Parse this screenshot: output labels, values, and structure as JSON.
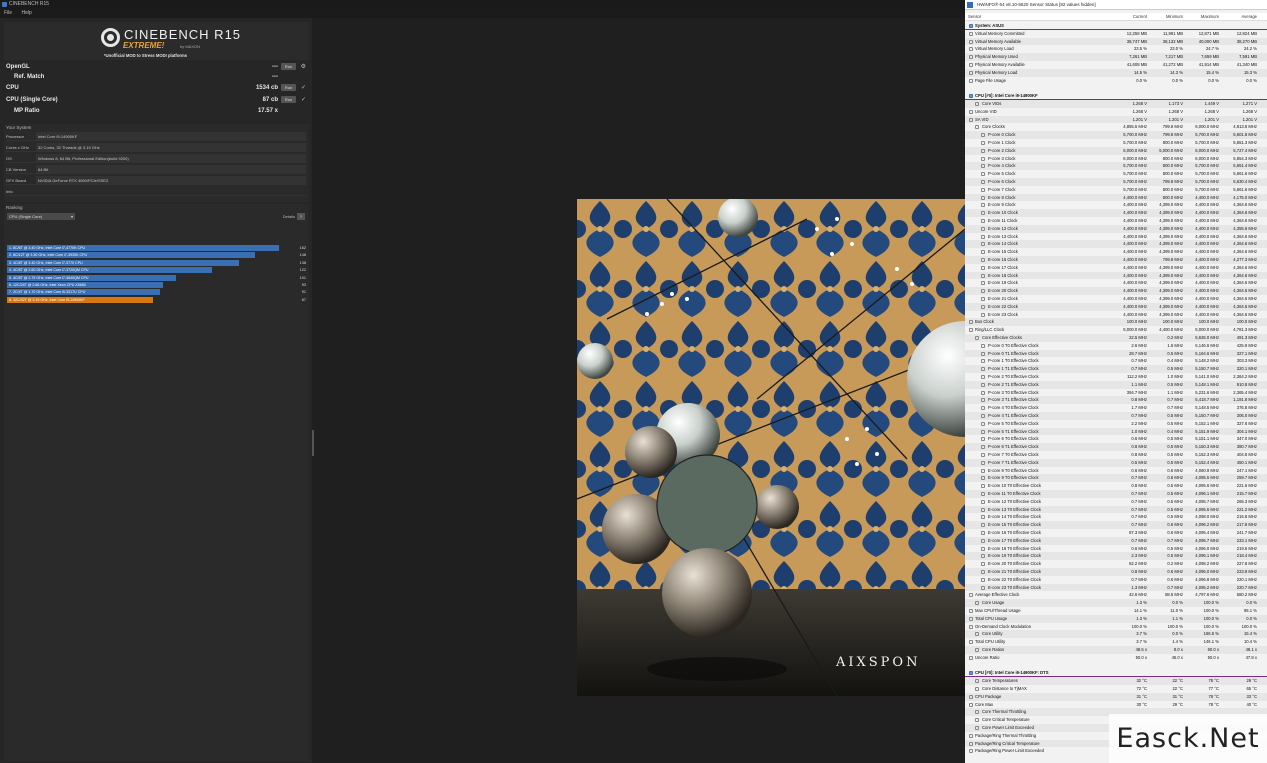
{
  "cinebench": {
    "window_title": "CINEBENCH R15",
    "menu": [
      "File",
      "Help"
    ],
    "logo": {
      "name": "CINEBENCH R15",
      "edition": "EXTREME!",
      "by": "by MAXON",
      "mod_note": "*Unofficial MOD to Stress MODI platforms"
    },
    "scores": {
      "opengl_label": "OpenGL",
      "opengl_value": "---",
      "refmatch_label": "Ref. Match",
      "refmatch_value": "---",
      "cpu_label": "CPU",
      "cpu_value": "1534 cb",
      "single_label": "CPU (Single Core)",
      "single_value": "87 cb",
      "mp_label": "MP Ratio",
      "mp_value": "17.57 x",
      "run_label": "Run"
    },
    "system": {
      "heading": "Your System",
      "rows": [
        {
          "k": "Processor",
          "v": "Intel Core i9-14900KF"
        },
        {
          "k": "Cores x GHz",
          "v": "32 Cores, 32 Threads @ 3.19 GHz"
        },
        {
          "k": "OS",
          "v": "Windows 8, 64 Bit, Professional Edition(build 9200)"
        },
        {
          "k": "CB Version",
          "v": "64 Bit"
        },
        {
          "k": "GFX Board",
          "v": "NVIDIA GeForce RTX 4080/PCIe/SSE2"
        },
        {
          "k": "Info",
          "v": ""
        }
      ]
    },
    "ranking": {
      "heading": "Ranking",
      "select": "CPU (Single Core)",
      "details": "Details",
      "info": "?",
      "items": [
        {
          "label": "1. 6C/6T @ 3.40 GHz, Intel Core i7-4770K CPU",
          "score": "162",
          "pct": 1.0,
          "mine": false
        },
        {
          "label": "2. 6C/12T @ 3.30 GHz, Intel Core i7-3930K CPU",
          "score": "148",
          "pct": 0.913,
          "mine": false
        },
        {
          "label": "3. 4C/8T @ 3.40 GHz, Intel Core i7-3770 CPU",
          "score": "138",
          "pct": 0.852,
          "mine": false
        },
        {
          "label": "4. 4C/8T @ 2.60 GHz, Intel Core i7-3720QM CPU",
          "score": "122",
          "pct": 0.753,
          "mine": false
        },
        {
          "label": "5. 4C/8T @ 2.79 GHz, Intel Core i7-3840QM CPU",
          "score": "101",
          "pct": 0.623,
          "mine": false
        },
        {
          "label": "6. 12C/24T @ 2.66 GHz, Intel Xeon CPU X5650",
          "score": "93",
          "pct": 0.574,
          "mine": false
        },
        {
          "label": "7. 2C/4T @ 1.70 GHz, Intel Core i5-3317U CPU",
          "score": "91",
          "pct": 0.562,
          "mine": false
        },
        {
          "label": "8. 32C/32T @ 3.19 GHz, Intel Core i9-14900KF",
          "score": "87",
          "pct": 0.537,
          "mine": true
        }
      ]
    },
    "scene_wordmark": "AIXSPON"
  },
  "hwinfo": {
    "window_title": "HWiNFO® 64 v8.10-5520 Sensor Status [82 values hidden]",
    "columns": {
      "sensor": "Sensor",
      "current": "Current",
      "min": "Minimum",
      "max": "Maximum",
      "avg": "Average"
    },
    "rows": [
      {
        "n": "System: ASUS",
        "sec": true
      },
      {
        "n": "Virtual Memory Committed",
        "c": [
          "12,258 MB",
          "11,991 MB",
          "12,871 MB",
          "12,824 MB"
        ]
      },
      {
        "n": "Virtual Memory Available",
        "c": [
          "38,747 MB",
          "38,132 MB",
          "40,000 MB",
          "38,270 MB"
        ]
      },
      {
        "n": "Virtual Memory Load",
        "c": [
          "23.5 %",
          "23.0 %",
          "24.7 %",
          "24.2 %"
        ]
      },
      {
        "n": "Physical Memory Used",
        "c": [
          "7,261 MB",
          "7,217 MB",
          "7,659 MB",
          "7,591 MB"
        ]
      },
      {
        "n": "Physical Memory Available",
        "c": [
          "41,608 MB",
          "41,272 MB",
          "41,914 MB",
          "41,340 MB"
        ]
      },
      {
        "n": "Physical Memory Load",
        "c": [
          "14.5 %",
          "14.3 %",
          "15.4 %",
          "15.3 %"
        ]
      },
      {
        "n": "Page File Usage",
        "c": [
          "0.0 %",
          "0.0 %",
          "0.0 %",
          "0.0 %"
        ]
      },
      {
        "n": "",
        "blank": true
      },
      {
        "n": "CPU [#0]: Intel Core i9-14900KF",
        "sec": true
      },
      {
        "n": "Core VIDs",
        "c": [
          "1.268 V",
          "1.173 V",
          "1.449 V",
          "1.271 V"
        ],
        "d": 2
      },
      {
        "n": "Uncore VID",
        "c": [
          "1.268 V",
          "1.268 V",
          "1.268 V",
          "1.268 V"
        ]
      },
      {
        "n": "SA VID",
        "c": [
          "1.201 V",
          "1.201 V",
          "1.201 V",
          "1.201 V"
        ]
      },
      {
        "n": "Core Clocks",
        "c": [
          "4,855.5 MHz",
          "799.8 MHz",
          "6,000.0 MHz",
          "4,813.8 MHz"
        ],
        "d": 2
      },
      {
        "n": "P-core 0 Clock",
        "c": [
          "5,700.0 MHz",
          "799.8 MHz",
          "5,700.0 MHz",
          "5,601.8 MHz"
        ],
        "d": 3
      },
      {
        "n": "P-core 1 Clock",
        "c": [
          "5,700.0 MHz",
          "800.0 MHz",
          "5,700.0 MHz",
          "5,651.3 MHz"
        ],
        "d": 3
      },
      {
        "n": "P-core 2 Clock",
        "c": [
          "6,000.0 MHz",
          "5,000.0 MHz",
          "6,000.0 MHz",
          "5,727.4 MHz"
        ],
        "d": 3
      },
      {
        "n": "P-core 3 Clock",
        "c": [
          "6,000.0 MHz",
          "800.0 MHz",
          "6,000.0 MHz",
          "5,854.3 MHz"
        ],
        "d": 3
      },
      {
        "n": "P-core 4 Clock",
        "c": [
          "5,700.0 MHz",
          "800.0 MHz",
          "5,700.0 MHz",
          "5,651.4 MHz"
        ],
        "d": 3
      },
      {
        "n": "P-core 5 Clock",
        "c": [
          "5,700.0 MHz",
          "800.0 MHz",
          "5,700.0 MHz",
          "5,661.6 MHz"
        ],
        "d": 3
      },
      {
        "n": "P-core 6 Clock",
        "c": [
          "5,700.0 MHz",
          "799.8 MHz",
          "5,700.0 MHz",
          "5,630.4 MHz"
        ],
        "d": 3
      },
      {
        "n": "P-core 7 Clock",
        "c": [
          "5,700.0 MHz",
          "800.0 MHz",
          "5,700.0 MHz",
          "5,661.6 MHz"
        ],
        "d": 3
      },
      {
        "n": "E-core 8 Clock",
        "c": [
          "4,400.0 MHz",
          "800.0 MHz",
          "4,400.0 MHz",
          "4,175.0 MHz"
        ],
        "d": 3
      },
      {
        "n": "E-core 9 Clock",
        "c": [
          "4,400.0 MHz",
          "4,399.0 MHz",
          "4,400.0 MHz",
          "4,364.6 MHz"
        ],
        "d": 3
      },
      {
        "n": "E-core 10 Clock",
        "c": [
          "4,400.0 MHz",
          "4,399.0 MHz",
          "4,400.0 MHz",
          "4,364.6 MHz"
        ],
        "d": 3
      },
      {
        "n": "E-core 11 Clock",
        "c": [
          "4,400.0 MHz",
          "4,399.0 MHz",
          "4,400.0 MHz",
          "4,364.6 MHz"
        ],
        "d": 3
      },
      {
        "n": "E-core 12 Clock",
        "c": [
          "4,400.0 MHz",
          "4,399.0 MHz",
          "4,400.0 MHz",
          "4,355.6 MHz"
        ],
        "d": 3
      },
      {
        "n": "E-core 13 Clock",
        "c": [
          "4,400.0 MHz",
          "4,399.0 MHz",
          "4,400.0 MHz",
          "4,364.6 MHz"
        ],
        "d": 3
      },
      {
        "n": "E-core 14 Clock",
        "c": [
          "4,400.0 MHz",
          "4,399.0 MHz",
          "4,400.0 MHz",
          "4,364.6 MHz"
        ],
        "d": 3
      },
      {
        "n": "E-core 15 Clock",
        "c": [
          "4,400.0 MHz",
          "4,399.0 MHz",
          "4,400.0 MHz",
          "4,364.6 MHz"
        ],
        "d": 3
      },
      {
        "n": "E-core 16 Clock",
        "c": [
          "4,400.0 MHz",
          "799.8 MHz",
          "4,400.0 MHz",
          "4,277.3 MHz"
        ],
        "d": 3
      },
      {
        "n": "E-core 17 Clock",
        "c": [
          "4,400.0 MHz",
          "4,399.0 MHz",
          "4,400.0 MHz",
          "4,364.6 MHz"
        ],
        "d": 3
      },
      {
        "n": "E-core 18 Clock",
        "c": [
          "4,400.0 MHz",
          "4,399.0 MHz",
          "4,400.0 MHz",
          "4,364.6 MHz"
        ],
        "d": 3
      },
      {
        "n": "E-core 19 Clock",
        "c": [
          "4,400.0 MHz",
          "4,399.0 MHz",
          "4,400.0 MHz",
          "4,364.6 MHz"
        ],
        "d": 3
      },
      {
        "n": "E-core 20 Clock",
        "c": [
          "4,400.0 MHz",
          "4,399.0 MHz",
          "4,400.0 MHz",
          "4,364.6 MHz"
        ],
        "d": 3
      },
      {
        "n": "E-core 21 Clock",
        "c": [
          "4,400.0 MHz",
          "4,399.0 MHz",
          "4,400.0 MHz",
          "4,364.6 MHz"
        ],
        "d": 3
      },
      {
        "n": "E-core 22 Clock",
        "c": [
          "4,400.0 MHz",
          "4,399.0 MHz",
          "4,400.0 MHz",
          "4,364.6 MHz"
        ],
        "d": 3
      },
      {
        "n": "E-core 23 Clock",
        "c": [
          "4,400.0 MHz",
          "4,399.0 MHz",
          "4,400.0 MHz",
          "4,364.6 MHz"
        ],
        "d": 3
      },
      {
        "n": "Bus Clock",
        "c": [
          "100.0 MHz",
          "100.0 MHz",
          "100.0 MHz",
          "100.0 MHz"
        ]
      },
      {
        "n": "Ring/LLC Clock",
        "c": [
          "5,000.0 MHz",
          "4,400.0 MHz",
          "5,000.0 MHz",
          "4,781.3 MHz"
        ]
      },
      {
        "n": "Core Effective Clocks",
        "c": [
          "22.5 MHz",
          "0.2 MHz",
          "5,636.0 MHz",
          "491.3 MHz"
        ],
        "d": 2
      },
      {
        "n": "P-core 0 T0 Effective Clock",
        "c": [
          "2.6 MHz",
          "1.6 MHz",
          "5,146.6 MHz",
          "425.9 MHz"
        ],
        "d": 3
      },
      {
        "n": "P-core 0 T1 Effective Clock",
        "c": [
          "28.7 MHz",
          "0.5 MHz",
          "5,164.6 MHz",
          "327.1 MHz"
        ],
        "d": 3
      },
      {
        "n": "P-core 1 T0 Effective Clock",
        "c": [
          "0.7 MHz",
          "0.4 MHz",
          "5,148.2 MHz",
          "303.3 MHz"
        ],
        "d": 3
      },
      {
        "n": "P-core 1 T1 Effective Clock",
        "c": [
          "0.7 MHz",
          "0.5 MHz",
          "5,150.7 MHz",
          "320.1 MHz"
        ],
        "d": 3
      },
      {
        "n": "P-core 2 T0 Effective Clock",
        "c": [
          "112.2 MHz",
          "1.0 MHz",
          "5,141.0 MHz",
          "2,364.2 MHz"
        ],
        "d": 3
      },
      {
        "n": "P-core 2 T1 Effective Clock",
        "c": [
          "1.1 MHz",
          "0.5 MHz",
          "5,148.1 MHz",
          "910.8 MHz"
        ],
        "d": 3
      },
      {
        "n": "P-core 3 T0 Effective Clock",
        "c": [
          "394.7 MHz",
          "1.1 MHz",
          "5,231.6 MHz",
          "2,365.4 MHz"
        ],
        "d": 3
      },
      {
        "n": "P-core 3 T1 Effective Clock",
        "c": [
          "0.8 MHz",
          "0.7 MHz",
          "5,418.7 MHz",
          "1,191.8 MHz"
        ],
        "d": 3
      },
      {
        "n": "P-core 4 T0 Effective Clock",
        "c": [
          "1.7 MHz",
          "0.7 MHz",
          "5,148.5 MHz",
          "376.8 MHz"
        ],
        "d": 3
      },
      {
        "n": "P-core 4 T1 Effective Clock",
        "c": [
          "0.7 MHz",
          "0.5 MHz",
          "5,150.7 MHz",
          "306.0 MHz"
        ],
        "d": 3
      },
      {
        "n": "P-core 5 T0 Effective Clock",
        "c": [
          "2.2 MHz",
          "0.5 MHz",
          "5,152.1 MHz",
          "327.6 MHz"
        ],
        "d": 3
      },
      {
        "n": "P-core 5 T1 Effective Clock",
        "c": [
          "1.0 MHz",
          "0.4 MHz",
          "5,151.9 MHz",
          "304.1 MHz"
        ],
        "d": 3
      },
      {
        "n": "P-core 6 T0 Effective Clock",
        "c": [
          "0.6 MHz",
          "0.5 MHz",
          "5,151.1 MHz",
          "347.0 MHz"
        ],
        "d": 3
      },
      {
        "n": "P-core 6 T1 Effective Clock",
        "c": [
          "0.8 MHz",
          "0.5 MHz",
          "5,150.3 MHz",
          "380.7 MHz"
        ],
        "d": 3
      },
      {
        "n": "P-core 7 T0 Effective Clock",
        "c": [
          "0.8 MHz",
          "0.5 MHz",
          "5,152.3 MHz",
          "404.8 MHz"
        ],
        "d": 3
      },
      {
        "n": "P-core 7 T1 Effective Clock",
        "c": [
          "0.5 MHz",
          "0.5 MHz",
          "5,152.4 MHz",
          "450.1 MHz"
        ],
        "d": 3
      },
      {
        "n": "E-core 8 T0 Effective Clock",
        "c": [
          "0.6 MHz",
          "0.6 MHz",
          "4,060.9 MHz",
          "247.1 MHz"
        ],
        "d": 3
      },
      {
        "n": "E-core 9 T0 Effective Clock",
        "c": [
          "0.7 MHz",
          "0.6 MHz",
          "4,095.5 MHz",
          "259.7 MHz"
        ],
        "d": 3
      },
      {
        "n": "E-core 10 T0 Effective Clock",
        "c": [
          "0.8 MHz",
          "0.5 MHz",
          "4,095.6 MHz",
          "221.6 MHz"
        ],
        "d": 3
      },
      {
        "n": "E-core 11 T0 Effective Clock",
        "c": [
          "0.7 MHz",
          "0.5 MHz",
          "4,096.1 MHz",
          "215.7 MHz"
        ],
        "d": 3
      },
      {
        "n": "E-core 12 T0 Effective Clock",
        "c": [
          "0.7 MHz",
          "0.5 MHz",
          "4,095.7 MHz",
          "265.3 MHz"
        ],
        "d": 3
      },
      {
        "n": "E-core 13 T0 Effective Clock",
        "c": [
          "0.7 MHz",
          "0.5 MHz",
          "4,095.6 MHz",
          "221.2 MHz"
        ],
        "d": 3
      },
      {
        "n": "E-core 14 T0 Effective Clock",
        "c": [
          "0.7 MHz",
          "0.5 MHz",
          "4,098.0 MHz",
          "216.8 MHz"
        ],
        "d": 3
      },
      {
        "n": "E-core 15 T0 Effective Clock",
        "c": [
          "0.7 MHz",
          "0.6 MHz",
          "4,096.2 MHz",
          "217.8 MHz"
        ],
        "d": 3
      },
      {
        "n": "E-core 16 T0 Effective Clock",
        "c": [
          "87.3 MHz",
          "0.6 MHz",
          "4,095.4 MHz",
          "241.7 MHz"
        ],
        "d": 3
      },
      {
        "n": "E-core 17 T0 Effective Clock",
        "c": [
          "0.7 MHz",
          "0.7 MHz",
          "4,095.7 MHz",
          "233.1 MHz"
        ],
        "d": 3
      },
      {
        "n": "E-core 18 T0 Effective Clock",
        "c": [
          "0.6 MHz",
          "0.5 MHz",
          "4,096.0 MHz",
          "219.6 MHz"
        ],
        "d": 3
      },
      {
        "n": "E-core 19 T0 Effective Clock",
        "c": [
          "2.3 MHz",
          "0.5 MHz",
          "4,096.1 MHz",
          "218.4 MHz"
        ],
        "d": 3
      },
      {
        "n": "E-core 20 T0 Effective Clock",
        "c": [
          "82.2 MHz",
          "0.2 MHz",
          "4,098.2 MHz",
          "227.8 MHz"
        ],
        "d": 3
      },
      {
        "n": "E-core 21 T0 Effective Clock",
        "c": [
          "0.8 MHz",
          "0.6 MHz",
          "4,096.0 MHz",
          "223.9 MHz"
        ],
        "d": 3
      },
      {
        "n": "E-core 22 T0 Effective Clock",
        "c": [
          "0.7 MHz",
          "0.6 MHz",
          "4,096.8 MHz",
          "220.1 MHz"
        ],
        "d": 3
      },
      {
        "n": "E-core 23 T0 Effective Clock",
        "c": [
          "1.3 MHz",
          "0.7 MHz",
          "4,095.2 MHz",
          "220.7 MHz"
        ],
        "d": 3
      },
      {
        "n": "Average Effective Clock",
        "c": [
          "42.6 MHz",
          "88.5 MHz",
          "4,797.6 MHz",
          "580.2 MHz"
        ]
      },
      {
        "n": "Core Usage",
        "c": [
          "1.3 %",
          "0.0 %",
          "100.0 %",
          "0.0 %"
        ],
        "d": 2
      },
      {
        "n": "Max CPU/Thread Usage",
        "c": [
          "14.1 %",
          "11.0 %",
          "100.0 %",
          "95.1 %"
        ]
      },
      {
        "n": "Total CPU Usage",
        "c": [
          "1.3 %",
          "1.1 %",
          "100.0 %",
          "0.0 %"
        ]
      },
      {
        "n": "On-Demand Clock Modulation",
        "c": [
          "100.0 %",
          "100.0 %",
          "100.0 %",
          "100.0 %"
        ]
      },
      {
        "n": "Core Utility",
        "c": [
          "3.7 %",
          "0.0 %",
          "166.5 %",
          "15.4 %"
        ],
        "d": 2
      },
      {
        "n": "Total CPU Utility",
        "c": [
          "3.7 %",
          "1.4 %",
          "146.1 %",
          "10.4 %"
        ]
      },
      {
        "n": "Core Ratios",
        "c": [
          "48.5 x",
          "8.0 x",
          "60.0 x",
          "48.1 x"
        ],
        "d": 2
      },
      {
        "n": "Uncore Ratio",
        "c": [
          "50.0 x",
          "45.0 x",
          "50.0 x",
          "47.8 x"
        ]
      },
      {
        "n": "",
        "blank": true
      },
      {
        "n": "CPU [#0]: Intel Core i9-14900KF: DTS",
        "sec": true
      },
      {
        "n": "Core Temperatures",
        "c": [
          "32 °C",
          "22 °C",
          "78 °C",
          "29 °C"
        ],
        "d": 2
      },
      {
        "n": "Core Distance to TjMAX",
        "c": [
          "72 °C",
          "22 °C",
          "77 °C",
          "65 °C"
        ],
        "d": 2
      },
      {
        "n": "CPU Package",
        "c": [
          "31 °C",
          "31 °C",
          "78 °C",
          "33 °C"
        ]
      },
      {
        "n": "Core Max",
        "c": [
          "30 °C",
          "29 °C",
          "78 °C",
          "40 °C"
        ]
      },
      {
        "n": "Core Thermal Throttling",
        "c": [
          "",
          "",
          "",
          ""
        ],
        "d": 2
      },
      {
        "n": "Core Critical Temperature",
        "c": [
          "",
          "",
          "",
          ""
        ],
        "d": 2
      },
      {
        "n": "Core Power Limit Exceeded",
        "c": [
          "",
          "",
          "",
          ""
        ],
        "d": 2
      },
      {
        "n": "Package/Ring Thermal Throttling",
        "c": [
          "",
          "",
          "",
          ""
        ]
      },
      {
        "n": "Package/Ring Critical Temperature",
        "c": [
          "",
          "",
          "",
          ""
        ]
      },
      {
        "n": "Package/Ring Power Limit Exceeded",
        "c": [
          "",
          "",
          "",
          ""
        ]
      }
    ]
  },
  "watermark": "Easck.Net"
}
